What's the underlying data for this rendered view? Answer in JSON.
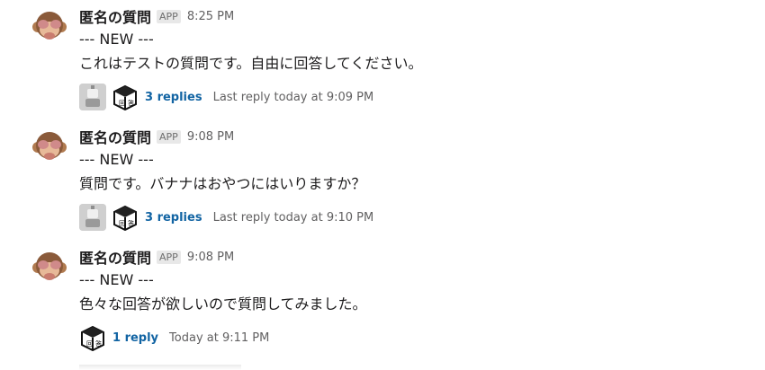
{
  "messages": [
    {
      "author": "匿名の質問",
      "badge": "APP",
      "time": "8:25 PM",
      "lines": [
        "--- NEW ---",
        "これはテストの質問です。自由に回答してください。"
      ],
      "thread": {
        "replies": "3 replies",
        "last": "Last reply today at 9:09 PM",
        "participants": [
          "robot",
          "cube"
        ]
      }
    },
    {
      "author": "匿名の質問",
      "badge": "APP",
      "time": "9:08 PM",
      "lines": [
        "--- NEW ---",
        "質問です。バナナはおやつにはいりますか？"
      ],
      "thread": {
        "replies": "3 replies",
        "last": "Last reply today at 9:10 PM",
        "participants": [
          "robot",
          "cube"
        ]
      }
    },
    {
      "author": "匿名の質問",
      "badge": "APP",
      "time": "9:08 PM",
      "lines": [
        "--- NEW ---",
        "色々な回答が欲しいので質問してみました。"
      ],
      "thread": {
        "replies": "1 reply",
        "last": "Today at 9:11 PM",
        "participants": [
          "cube"
        ]
      }
    }
  ],
  "colors": {
    "link": "#1264a3",
    "muted": "#616061",
    "text": "#1d1c1d"
  },
  "icons": {
    "avatar": "see-no-evil-monkey-icon",
    "robot": "robot-avatar-icon",
    "cube": "cube-logo-avatar-icon"
  }
}
